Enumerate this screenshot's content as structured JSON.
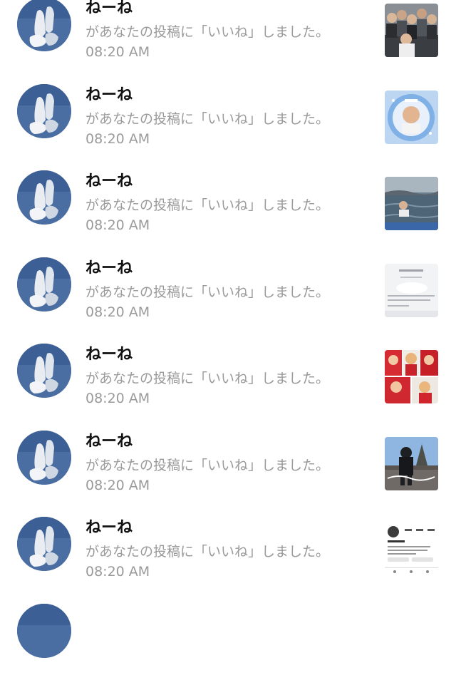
{
  "notifications": [
    {
      "name": "ねーね",
      "message": "があなたの投稿に「いいね」しました。",
      "time": "08:20 AM",
      "thumbnail": "group-photo-thumbnail"
    },
    {
      "name": "ねーね",
      "message": "があなたの投稿に「いいね」しました。",
      "time": "08:20 AM",
      "thumbnail": "framed-portrait-thumbnail"
    },
    {
      "name": "ねーね",
      "message": "があなたの投稿に「いいね」しました。",
      "time": "08:20 AM",
      "thumbnail": "water-photo-thumbnail"
    },
    {
      "name": "ねーね",
      "message": "があなたの投稿に「いいね」しました。",
      "time": "08:20 AM",
      "thumbnail": "document-photo-thumbnail"
    },
    {
      "name": "ねーね",
      "message": "があなたの投稿に「いいね」しました。",
      "time": "08:20 AM",
      "thumbnail": "collage-photo-thumbnail"
    },
    {
      "name": "ねーね",
      "message": "があなたの投稿に「いいね」しました。",
      "time": "08:20 AM",
      "thumbnail": "outdoor-photo-thumbnail"
    },
    {
      "name": "ねーね",
      "message": "があなたの投稿に「いいね」しました。",
      "time": "08:20 AM",
      "thumbnail": "profile-screenshot-thumbnail"
    }
  ],
  "colors": {
    "name_text": "#111111",
    "secondary_text": "#9a9a9a",
    "avatar_sky": "#4b6fa3",
    "background": "#ffffff"
  }
}
